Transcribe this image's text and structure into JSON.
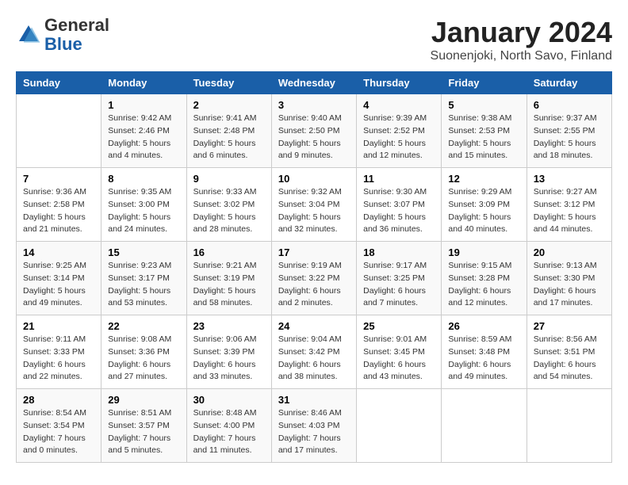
{
  "logo": {
    "general": "General",
    "blue": "Blue"
  },
  "header": {
    "title": "January 2024",
    "subtitle": "Suonenjoki, North Savo, Finland"
  },
  "weekdays": [
    "Sunday",
    "Monday",
    "Tuesday",
    "Wednesday",
    "Thursday",
    "Friday",
    "Saturday"
  ],
  "weeks": [
    [
      {
        "day": "",
        "info": ""
      },
      {
        "day": "1",
        "info": "Sunrise: 9:42 AM\nSunset: 2:46 PM\nDaylight: 5 hours\nand 4 minutes."
      },
      {
        "day": "2",
        "info": "Sunrise: 9:41 AM\nSunset: 2:48 PM\nDaylight: 5 hours\nand 6 minutes."
      },
      {
        "day": "3",
        "info": "Sunrise: 9:40 AM\nSunset: 2:50 PM\nDaylight: 5 hours\nand 9 minutes."
      },
      {
        "day": "4",
        "info": "Sunrise: 9:39 AM\nSunset: 2:52 PM\nDaylight: 5 hours\nand 12 minutes."
      },
      {
        "day": "5",
        "info": "Sunrise: 9:38 AM\nSunset: 2:53 PM\nDaylight: 5 hours\nand 15 minutes."
      },
      {
        "day": "6",
        "info": "Sunrise: 9:37 AM\nSunset: 2:55 PM\nDaylight: 5 hours\nand 18 minutes."
      }
    ],
    [
      {
        "day": "7",
        "info": "Sunrise: 9:36 AM\nSunset: 2:58 PM\nDaylight: 5 hours\nand 21 minutes."
      },
      {
        "day": "8",
        "info": "Sunrise: 9:35 AM\nSunset: 3:00 PM\nDaylight: 5 hours\nand 24 minutes."
      },
      {
        "day": "9",
        "info": "Sunrise: 9:33 AM\nSunset: 3:02 PM\nDaylight: 5 hours\nand 28 minutes."
      },
      {
        "day": "10",
        "info": "Sunrise: 9:32 AM\nSunset: 3:04 PM\nDaylight: 5 hours\nand 32 minutes."
      },
      {
        "day": "11",
        "info": "Sunrise: 9:30 AM\nSunset: 3:07 PM\nDaylight: 5 hours\nand 36 minutes."
      },
      {
        "day": "12",
        "info": "Sunrise: 9:29 AM\nSunset: 3:09 PM\nDaylight: 5 hours\nand 40 minutes."
      },
      {
        "day": "13",
        "info": "Sunrise: 9:27 AM\nSunset: 3:12 PM\nDaylight: 5 hours\nand 44 minutes."
      }
    ],
    [
      {
        "day": "14",
        "info": "Sunrise: 9:25 AM\nSunset: 3:14 PM\nDaylight: 5 hours\nand 49 minutes."
      },
      {
        "day": "15",
        "info": "Sunrise: 9:23 AM\nSunset: 3:17 PM\nDaylight: 5 hours\nand 53 minutes."
      },
      {
        "day": "16",
        "info": "Sunrise: 9:21 AM\nSunset: 3:19 PM\nDaylight: 5 hours\nand 58 minutes."
      },
      {
        "day": "17",
        "info": "Sunrise: 9:19 AM\nSunset: 3:22 PM\nDaylight: 6 hours\nand 2 minutes."
      },
      {
        "day": "18",
        "info": "Sunrise: 9:17 AM\nSunset: 3:25 PM\nDaylight: 6 hours\nand 7 minutes."
      },
      {
        "day": "19",
        "info": "Sunrise: 9:15 AM\nSunset: 3:28 PM\nDaylight: 6 hours\nand 12 minutes."
      },
      {
        "day": "20",
        "info": "Sunrise: 9:13 AM\nSunset: 3:30 PM\nDaylight: 6 hours\nand 17 minutes."
      }
    ],
    [
      {
        "day": "21",
        "info": "Sunrise: 9:11 AM\nSunset: 3:33 PM\nDaylight: 6 hours\nand 22 minutes."
      },
      {
        "day": "22",
        "info": "Sunrise: 9:08 AM\nSunset: 3:36 PM\nDaylight: 6 hours\nand 27 minutes."
      },
      {
        "day": "23",
        "info": "Sunrise: 9:06 AM\nSunset: 3:39 PM\nDaylight: 6 hours\nand 33 minutes."
      },
      {
        "day": "24",
        "info": "Sunrise: 9:04 AM\nSunset: 3:42 PM\nDaylight: 6 hours\nand 38 minutes."
      },
      {
        "day": "25",
        "info": "Sunrise: 9:01 AM\nSunset: 3:45 PM\nDaylight: 6 hours\nand 43 minutes."
      },
      {
        "day": "26",
        "info": "Sunrise: 8:59 AM\nSunset: 3:48 PM\nDaylight: 6 hours\nand 49 minutes."
      },
      {
        "day": "27",
        "info": "Sunrise: 8:56 AM\nSunset: 3:51 PM\nDaylight: 6 hours\nand 54 minutes."
      }
    ],
    [
      {
        "day": "28",
        "info": "Sunrise: 8:54 AM\nSunset: 3:54 PM\nDaylight: 7 hours\nand 0 minutes."
      },
      {
        "day": "29",
        "info": "Sunrise: 8:51 AM\nSunset: 3:57 PM\nDaylight: 7 hours\nand 5 minutes."
      },
      {
        "day": "30",
        "info": "Sunrise: 8:48 AM\nSunset: 4:00 PM\nDaylight: 7 hours\nand 11 minutes."
      },
      {
        "day": "31",
        "info": "Sunrise: 8:46 AM\nSunset: 4:03 PM\nDaylight: 7 hours\nand 17 minutes."
      },
      {
        "day": "",
        "info": ""
      },
      {
        "day": "",
        "info": ""
      },
      {
        "day": "",
        "info": ""
      }
    ]
  ]
}
